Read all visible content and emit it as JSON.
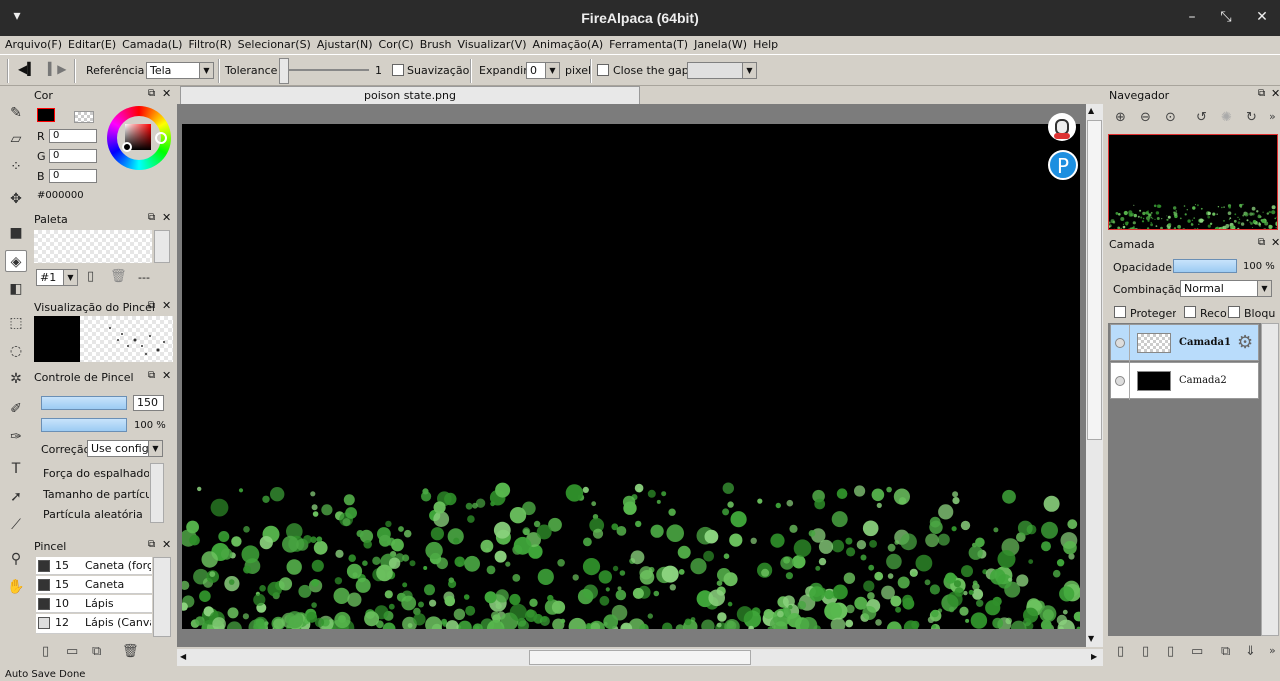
{
  "window": {
    "title": "FireAlpaca (64bit)"
  },
  "menu": [
    "Arquivo(F)",
    "Editar(E)",
    "Camada(L)",
    "Filtro(R)",
    "Selecionar(S)",
    "Ajustar(N)",
    "Cor(C)",
    "Brush",
    "Visualizar(V)",
    "Animação(A)",
    "Ferramenta(T)",
    "Janela(W)",
    "Help"
  ],
  "toolbar": {
    "reference_label": "Referência",
    "reference_value": "Tela",
    "tolerance_label": "Tolerance",
    "tolerance_value": "1",
    "smoothing_label": "Suavização",
    "expand_label": "Expandir",
    "expand_value": "0",
    "pixel_label": "pixel",
    "close_gap_label": "Close the gap"
  },
  "color_panel": {
    "title": "Cor",
    "r_label": "R",
    "g_label": "G",
    "b_label": "B",
    "r": "0",
    "g": "0",
    "b": "0",
    "hex": "#000000",
    "primary": "#000000"
  },
  "palette_panel": {
    "title": "Paleta",
    "index": "#1",
    "dashes": "---"
  },
  "brush_preview_panel": {
    "title": "Visualização do Pincel"
  },
  "brush_control_panel": {
    "title": "Controle de Pincel",
    "size": "150",
    "opacity": "100 %",
    "correction_label": "Correção",
    "correction_value": "Use configu",
    "param1": "Força do espalhador",
    "param2": "Tamanho de partícula",
    "param3": "Partícula aleatória"
  },
  "brush_panel": {
    "title": "Pincel",
    "items": [
      {
        "size": "15",
        "name": "Caneta (força"
      },
      {
        "size": "15",
        "name": "Caneta"
      },
      {
        "size": "10",
        "name": "Lápis"
      },
      {
        "size": "12",
        "name": "Lápis (Canva"
      }
    ]
  },
  "document": {
    "tab": "poison state.png"
  },
  "navigator_panel": {
    "title": "Navegador"
  },
  "layer_panel": {
    "title": "Camada",
    "opacity_label": "Opacidade",
    "opacity_value": "100 %",
    "blend_label": "Combinação",
    "blend_value": "Normal",
    "protect_label": "Proteger A",
    "clip_label": "Reco",
    "lock_label": "Bloqu",
    "layers": [
      {
        "name": "Camada1"
      },
      {
        "name": "Camada2"
      }
    ]
  },
  "status": {
    "text": "Auto Save Done"
  }
}
